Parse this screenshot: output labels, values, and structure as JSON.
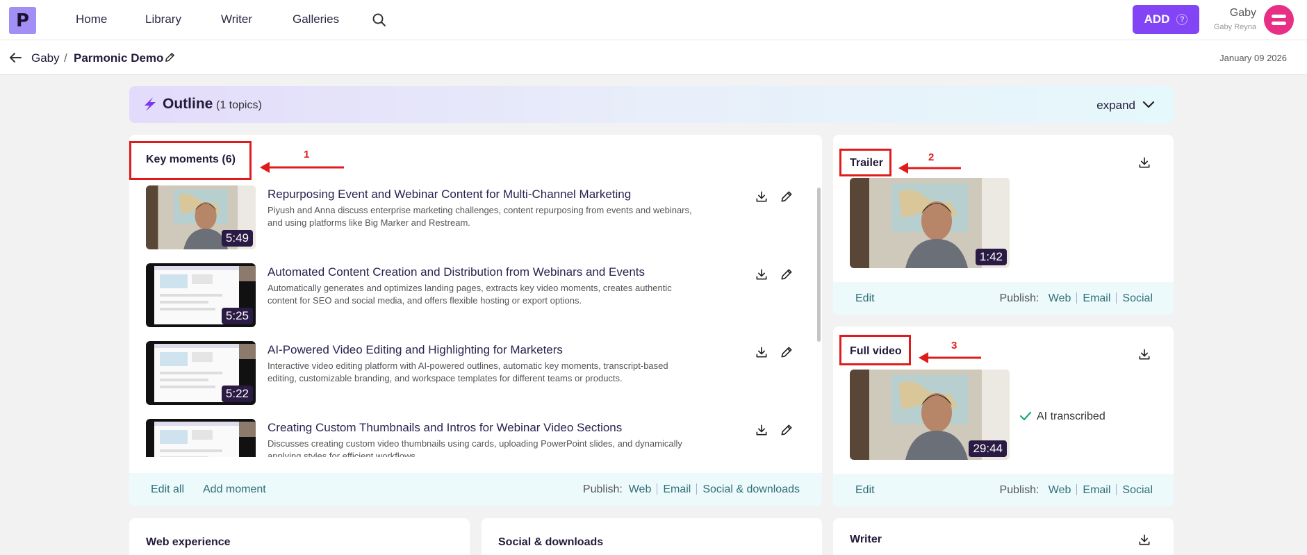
{
  "topbar": {
    "logo_letter": "P",
    "nav": [
      "Home",
      "Library",
      "Writer",
      "Galleries"
    ],
    "add_label": "ADD",
    "user_name": "Gaby",
    "user_sub": "Gaby Reyna"
  },
  "breadcrumb": {
    "parent": "Gaby",
    "separator": "/",
    "current": "Parmonic Demo",
    "date": "January 09 2026"
  },
  "outline": {
    "title": "Outline",
    "count": "(1 topics)",
    "expand": "expand"
  },
  "key_moments": {
    "title": "Key moments (6)",
    "annotation": "1",
    "items": [
      {
        "title": "Repurposing Event and Webinar Content for Multi-Channel Marketing",
        "desc": "Piyush and Anna discuss enterprise marketing challenges, content repurposing from events and webinars, and using platforms like Big Marker and Restream.",
        "duration": "5:49"
      },
      {
        "title": "Automated Content Creation and Distribution from Webinars and Events",
        "desc": "Automatically generates and optimizes landing pages, extracts key video moments, creates authentic content for SEO and social media, and offers flexible hosting or export options.",
        "duration": "5:25"
      },
      {
        "title": "AI-Powered Video Editing and Highlighting for Marketers",
        "desc": "Interactive video editing platform with AI-powered outlines, automatic key moments, transcript-based editing, customizable branding, and workspace templates for different teams or products.",
        "duration": "5:22"
      },
      {
        "title": "Creating Custom Thumbnails and Intros for Webinar Video Sections",
        "desc": "Discusses creating custom video thumbnails using cards, uploading PowerPoint slides, and dynamically applying styles for efficient workflows.",
        "duration": ""
      }
    ],
    "footer": {
      "edit_all": "Edit all",
      "add_moment": "Add moment",
      "publish": "Publish:",
      "web": "Web",
      "email": "Email",
      "social": "Social & downloads"
    }
  },
  "trailer": {
    "title": "Trailer",
    "annotation": "2",
    "duration": "1:42",
    "footer": {
      "edit": "Edit",
      "publish": "Publish:",
      "web": "Web",
      "email": "Email",
      "social": "Social"
    }
  },
  "full_video": {
    "title": "Full video",
    "annotation": "3",
    "duration": "29:44",
    "status": "AI transcribed",
    "footer": {
      "edit": "Edit",
      "publish": "Publish:",
      "web": "Web",
      "email": "Email",
      "social": "Social"
    }
  },
  "bottom_cards": {
    "web": "Web experience",
    "social": "Social & downloads",
    "writer": "Writer"
  },
  "colors": {
    "accent": "#8244f5",
    "annotation_red": "#e01b1b",
    "link_teal": "#2f6e76"
  }
}
